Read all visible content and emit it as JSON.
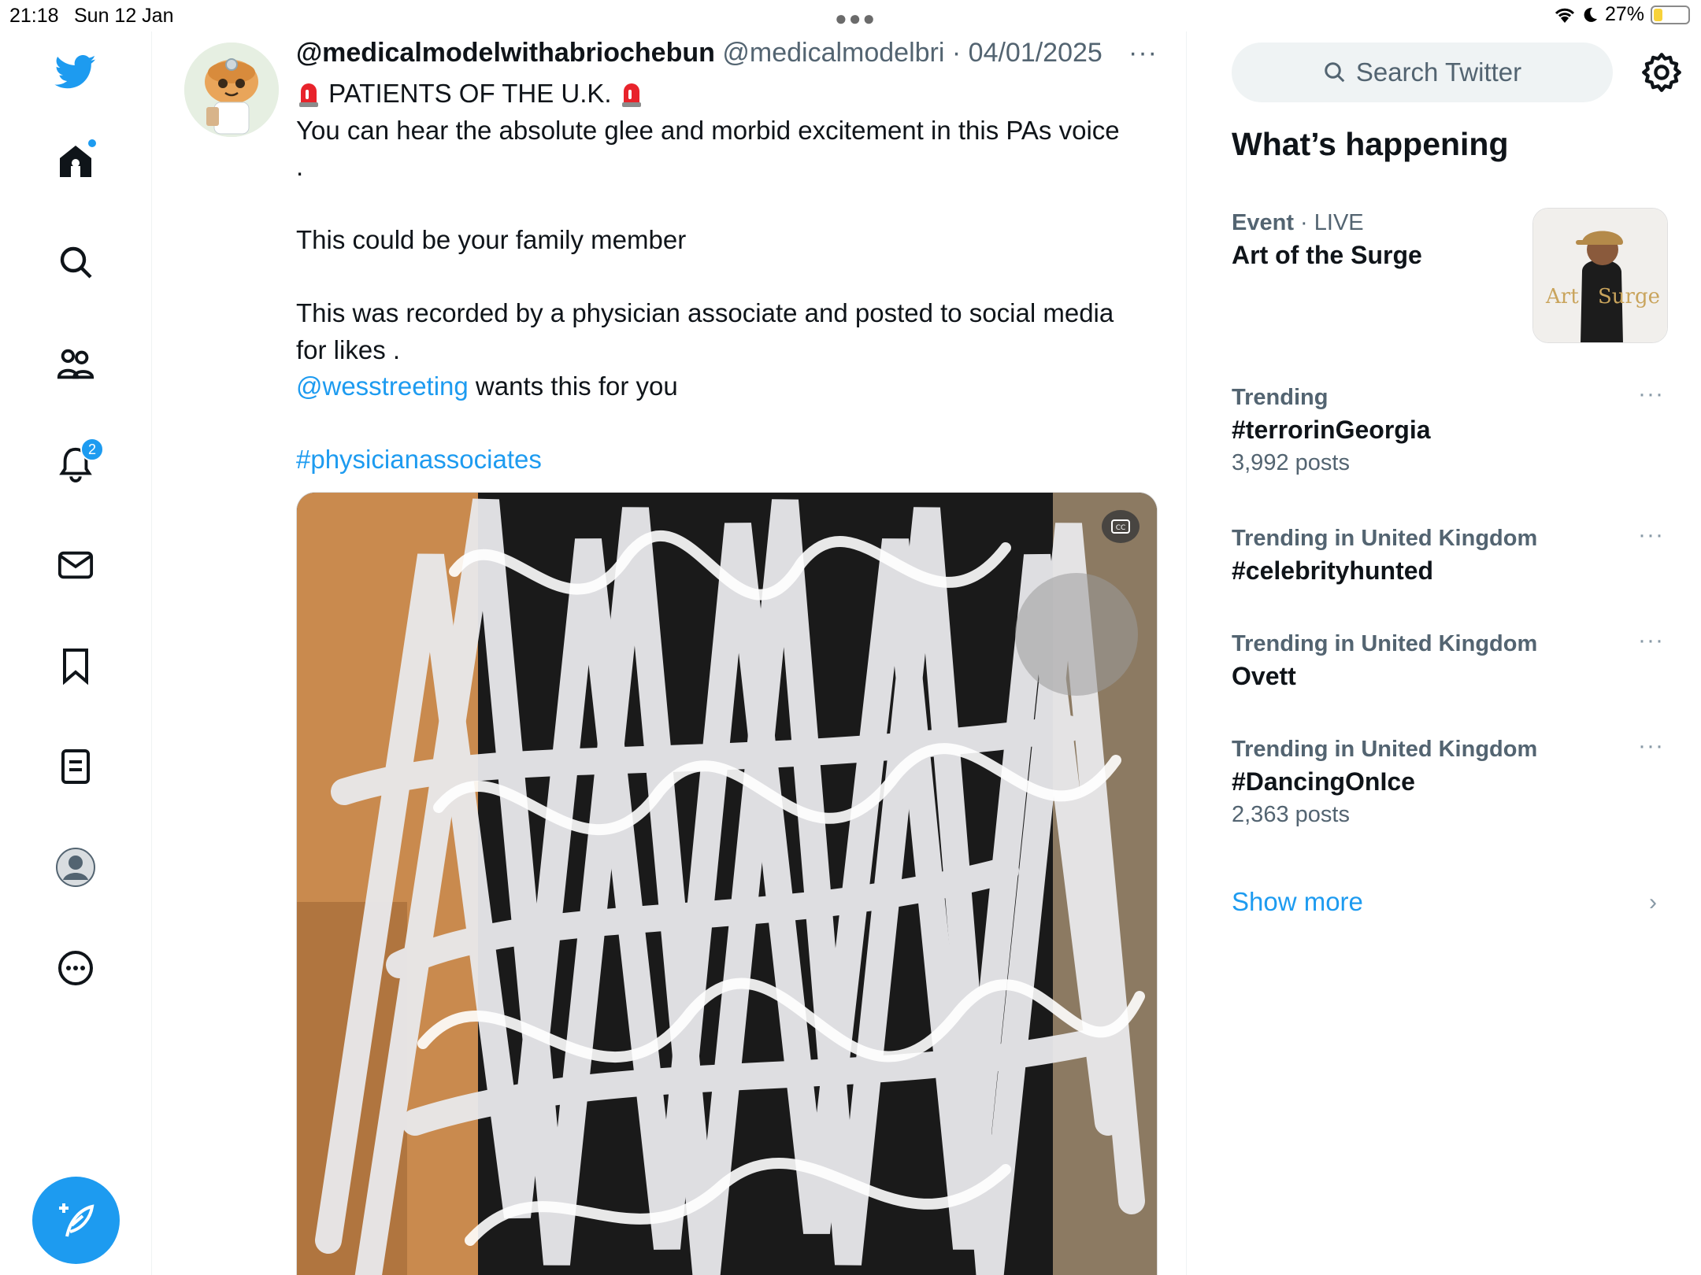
{
  "status_bar": {
    "time": "21:18",
    "date": "Sun 12 Jan",
    "battery_percent": "27%",
    "battery_level": 0.27
  },
  "nav": {
    "notifications_badge": "2",
    "items": [
      "twitter-logo",
      "home-icon",
      "search-icon",
      "communities-icon",
      "notifications-icon",
      "messages-icon",
      "bookmarks-icon",
      "lists-icon",
      "profile-icon",
      "more-icon"
    ]
  },
  "tweet": {
    "display_name": "@medicalmodelwithabriochebun",
    "handle": "@medicalmodelbri",
    "separator": "·",
    "date": "04/01/2025",
    "more": "···",
    "line1": "PATIENTS OF THE U.K.",
    "line2": "You can hear the absolute glee and morbid excitement in this PAs voice",
    "line3": ".",
    "line4": "This could be your family member",
    "line5": "This was recorded by a physician associate and posted to social media",
    "line6": "for likes .",
    "mention": "@wesstreeting",
    "line7_rest": " wants this for you",
    "hashtag": "#physicianassociates"
  },
  "sidebar": {
    "search_placeholder": "Search Twitter",
    "heading": "What’s happening",
    "event": {
      "category": "Event",
      "separator": " · ",
      "status": "LIVE",
      "title": "Art of the Surge",
      "image_text_1": "Art",
      "image_text_2": "Surge"
    },
    "trends": [
      {
        "meta": "Trending",
        "title": "#terrorinGeorgia",
        "count": "3,992 posts"
      },
      {
        "meta": "Trending in United Kingdom",
        "title": "#celebrityhunted",
        "count": ""
      },
      {
        "meta": "Trending in United Kingdom",
        "title": "Ovett",
        "count": ""
      },
      {
        "meta": "Trending in United Kingdom",
        "title": "#DancingOnIce",
        "count": "2,363 posts"
      }
    ],
    "more_glyph": "···",
    "show_more": "Show more",
    "chevron": "›"
  },
  "colors": {
    "accent": "#1d9bf0",
    "text_primary": "#0f1419",
    "text_secondary": "#536471",
    "search_bg": "#eff3f4"
  }
}
